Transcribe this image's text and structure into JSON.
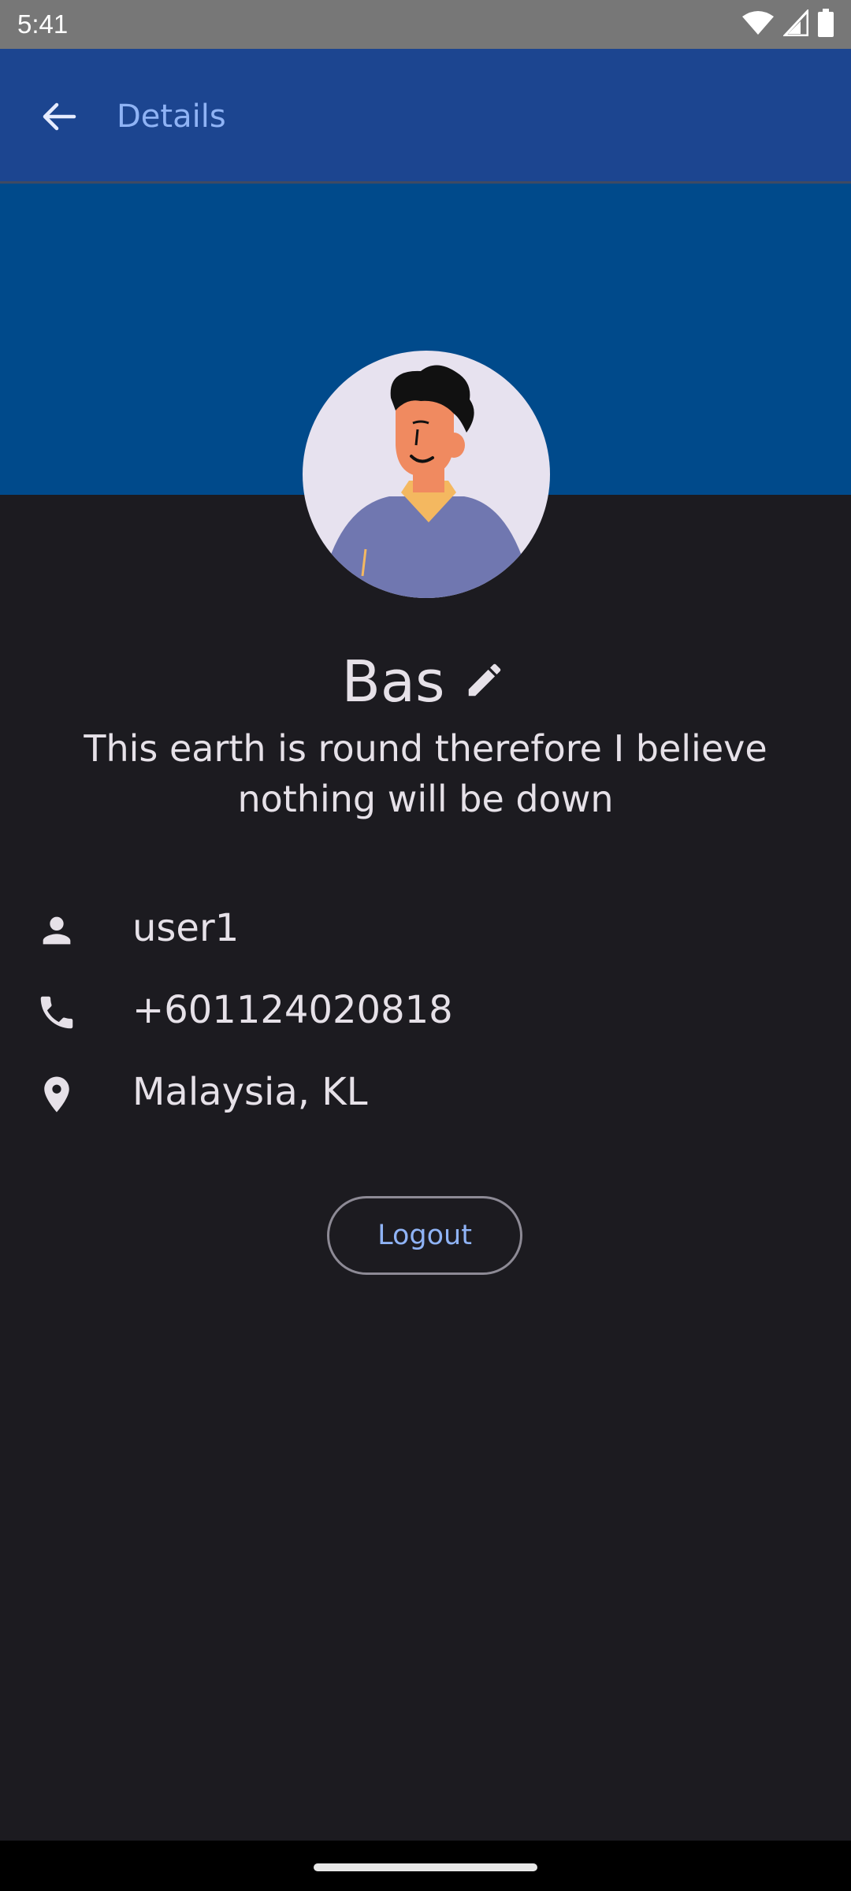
{
  "status_bar": {
    "time": "5:41",
    "icons": [
      "wifi-icon",
      "signal-icon",
      "battery-icon"
    ]
  },
  "app_bar": {
    "title": "Details",
    "back_icon": "arrow-back-icon"
  },
  "profile": {
    "name": "Bas",
    "edit_icon": "pencil-icon",
    "bio": "This earth is round therefore I believe nothing will be down"
  },
  "info": {
    "username": "user1",
    "phone": "+601124020818",
    "location": "Malaysia, KL"
  },
  "actions": {
    "logout_label": "Logout"
  },
  "colors": {
    "app_bar": "#1c4590",
    "banner": "#004a8b",
    "background": "#1c1b20",
    "accent_text": "#8fb3f5"
  }
}
